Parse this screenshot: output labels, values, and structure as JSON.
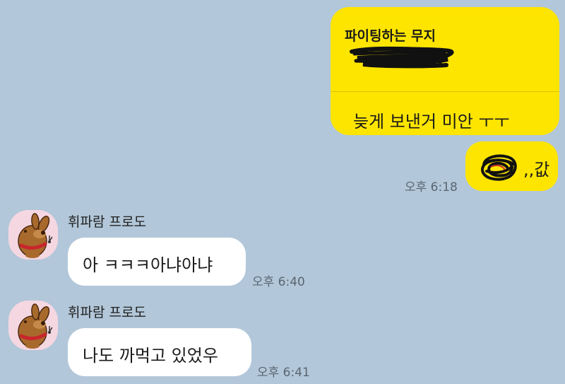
{
  "chat": {
    "outgoing_card": {
      "quote_sender": "파이팅하는 무지",
      "message": "늦게 보낸거 미안 ㅜㅜ"
    },
    "outgoing_small": {
      "text": ",,값",
      "time": "오후 6:18"
    },
    "incoming": [
      {
        "sender": "휘파람 프로도",
        "message": "아 ㅋㅋㅋ아냐아냐",
        "time": "오후 6:40"
      },
      {
        "sender": "휘파람 프로도",
        "message": "나도 까먹고 있었우",
        "time": "오후 6:41"
      }
    ]
  }
}
